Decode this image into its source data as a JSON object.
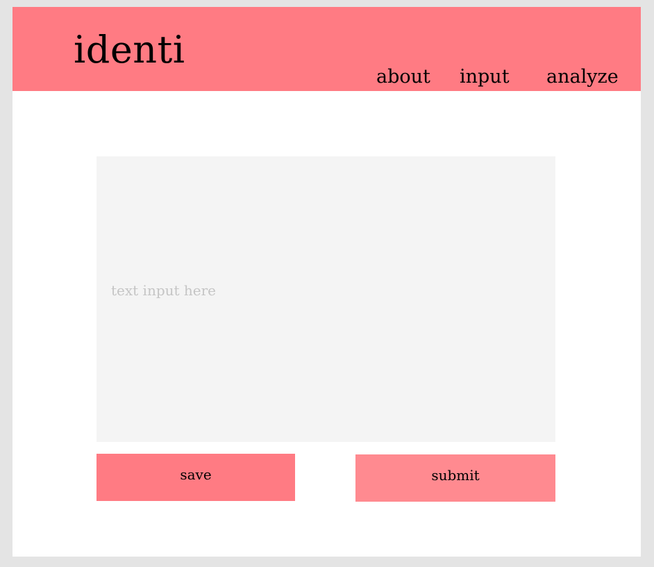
{
  "header": {
    "logo": "identi",
    "nav": {
      "about": "about",
      "input": "input",
      "analyze": "analyze"
    },
    "color": "#ff7b83"
  },
  "main": {
    "text_input": {
      "placeholder": "text input here",
      "value": ""
    },
    "buttons": {
      "save": "save",
      "submit": "submit"
    }
  },
  "colors": {
    "accent": "#ff7b83",
    "submit": "#ff8a90",
    "input_bg": "#f4f4f4",
    "page_bg": "#e4e4e4"
  }
}
